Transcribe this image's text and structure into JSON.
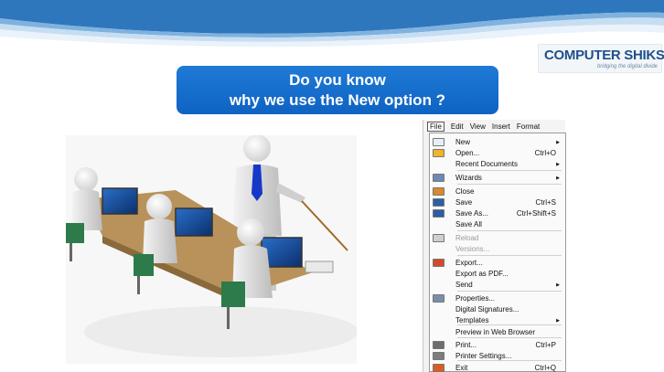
{
  "logo": {
    "main": "COMPUTER SHIKSHA",
    "tagline": "bridging the digital divide"
  },
  "question": {
    "line1": "Do you know",
    "line2": "why we use the New option ?"
  },
  "menubar": [
    "File",
    "Edit",
    "View",
    "Insert",
    "Format"
  ],
  "menu_items": [
    {
      "label": "New",
      "shortcut": "",
      "arrow": true,
      "icon": "new-document-icon",
      "disabled": false
    },
    {
      "label": "Open...",
      "shortcut": "Ctrl+O",
      "arrow": false,
      "icon": "open-folder-icon",
      "disabled": false
    },
    {
      "label": "Recent Documents",
      "shortcut": "",
      "arrow": true,
      "icon": "",
      "disabled": false
    },
    {
      "label": "Wizards",
      "shortcut": "",
      "arrow": true,
      "icon": "wizard-icon",
      "disabled": false
    },
    {
      "label": "Close",
      "shortcut": "",
      "arrow": false,
      "icon": "close-document-icon",
      "disabled": false
    },
    {
      "label": "Save",
      "shortcut": "Ctrl+S",
      "arrow": false,
      "icon": "save-icon",
      "disabled": false
    },
    {
      "label": "Save As...",
      "shortcut": "Ctrl+Shift+S",
      "arrow": false,
      "icon": "save-as-icon",
      "disabled": false
    },
    {
      "label": "Save All",
      "shortcut": "",
      "arrow": false,
      "icon": "",
      "disabled": false
    },
    {
      "label": "Reload",
      "shortcut": "",
      "arrow": false,
      "icon": "reload-icon",
      "disabled": true
    },
    {
      "label": "Versions...",
      "shortcut": "",
      "arrow": false,
      "icon": "",
      "disabled": true
    },
    {
      "label": "Export...",
      "shortcut": "",
      "arrow": false,
      "icon": "export-icon",
      "disabled": false
    },
    {
      "label": "Export as PDF...",
      "shortcut": "",
      "arrow": false,
      "icon": "",
      "disabled": false
    },
    {
      "label": "Send",
      "shortcut": "",
      "arrow": true,
      "icon": "",
      "disabled": false
    },
    {
      "label": "Properties...",
      "shortcut": "",
      "arrow": false,
      "icon": "properties-icon",
      "disabled": false
    },
    {
      "label": "Digital Signatures...",
      "shortcut": "",
      "arrow": false,
      "icon": "",
      "disabled": false
    },
    {
      "label": "Templates",
      "shortcut": "",
      "arrow": true,
      "icon": "",
      "disabled": false
    },
    {
      "label": "Preview in Web Browser",
      "shortcut": "",
      "arrow": false,
      "icon": "",
      "disabled": false
    },
    {
      "label": "Print...",
      "shortcut": "Ctrl+P",
      "arrow": false,
      "icon": "print-icon",
      "disabled": false
    },
    {
      "label": "Printer Settings...",
      "shortcut": "",
      "arrow": false,
      "icon": "printer-settings-icon",
      "disabled": false
    },
    {
      "label": "Exit",
      "shortcut": "Ctrl+Q",
      "arrow": false,
      "icon": "exit-icon",
      "disabled": false
    }
  ],
  "colors": {
    "accent": "#1a6fcf",
    "banner_light": "#dbeaf6",
    "banner_dark": "#3b82c4"
  }
}
